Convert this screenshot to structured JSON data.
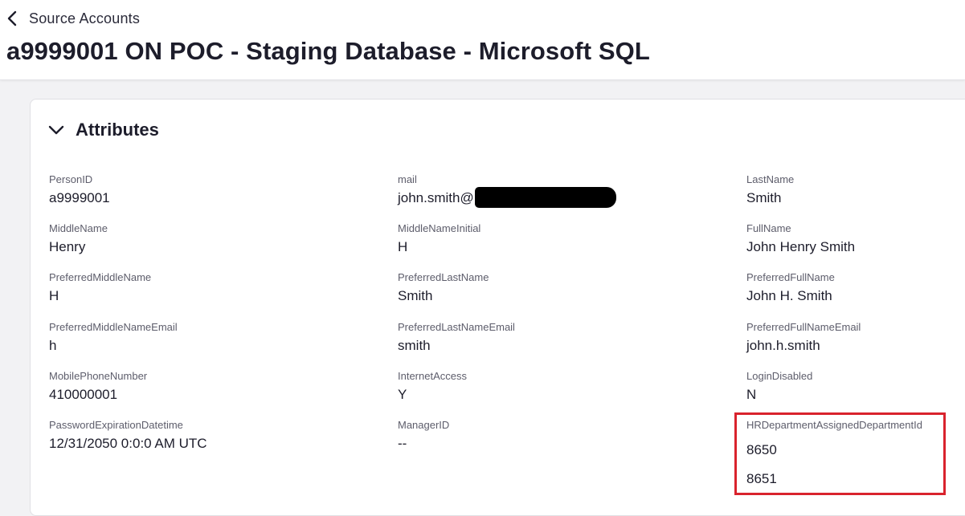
{
  "header": {
    "back_label": "Source Accounts",
    "title": "a9999001 ON POC - Staging Database - Microsoft SQL"
  },
  "section": {
    "title": "Attributes"
  },
  "attributes": {
    "person_id": {
      "label": "PersonID",
      "value": "a9999001"
    },
    "mail": {
      "label": "mail",
      "value": "john.smith@"
    },
    "last_name": {
      "label": "LastName",
      "value": "Smith"
    },
    "middle_name": {
      "label": "MiddleName",
      "value": "Henry"
    },
    "middle_name_initial": {
      "label": "MiddleNameInitial",
      "value": "H"
    },
    "full_name": {
      "label": "FullName",
      "value": "John Henry Smith"
    },
    "preferred_middle_name": {
      "label": "PreferredMiddleName",
      "value": "H"
    },
    "preferred_last_name": {
      "label": "PreferredLastName",
      "value": "Smith"
    },
    "preferred_full_name": {
      "label": "PreferredFullName",
      "value": "John H. Smith"
    },
    "preferred_middle_name_email": {
      "label": "PreferredMiddleNameEmail",
      "value": "h"
    },
    "preferred_last_name_email": {
      "label": "PreferredLastNameEmail",
      "value": "smith"
    },
    "preferred_full_name_email": {
      "label": "PreferredFullNameEmail",
      "value": "john.h.smith"
    },
    "mobile_phone_number": {
      "label": "MobilePhoneNumber",
      "value": "410000001"
    },
    "internet_access": {
      "label": "InternetAccess",
      "value": "Y"
    },
    "login_disabled": {
      "label": "LoginDisabled",
      "value": "N"
    },
    "password_expiration": {
      "label": "PasswordExpirationDatetime",
      "value": "12/31/2050 0:0:0 AM UTC"
    },
    "manager_id": {
      "label": "ManagerID",
      "value": "--"
    },
    "hr_department": {
      "label": "HRDepartmentAssignedDepartmentId",
      "values": [
        "8650",
        "8651"
      ]
    }
  },
  "colors": {
    "highlight": "#d9232d",
    "background": "#f2f2f4"
  },
  "icons": {
    "back": "chevron-left-icon",
    "section_toggle": "chevron-down-icon"
  }
}
